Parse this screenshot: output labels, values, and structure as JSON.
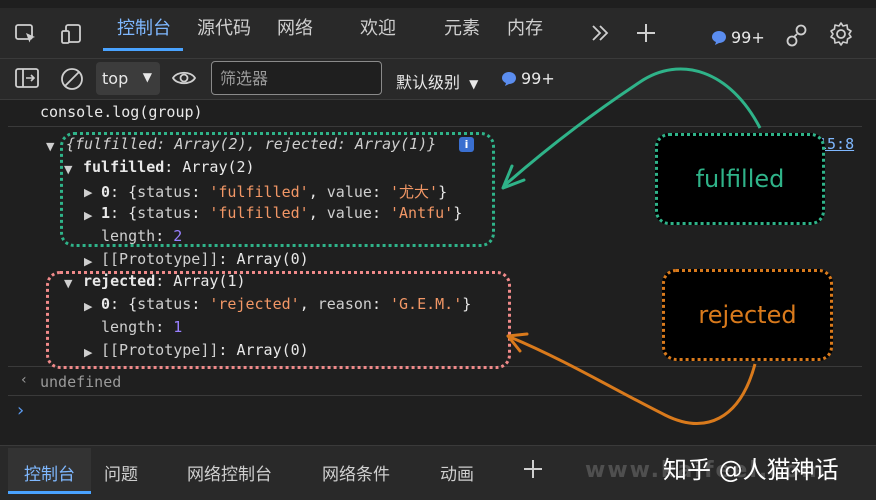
{
  "top_tabs": {
    "console": "控制台",
    "sources": "源代码",
    "network": "网络",
    "welcome": "欢迎",
    "elements": "元素",
    "memory": "内存",
    "issues_count": "99+"
  },
  "toolbar": {
    "context": "top",
    "filter_placeholder": "筛选器",
    "levels": "默认级别",
    "issues_count": "99+"
  },
  "console": {
    "command": "console.log(group)",
    "summary_open": "{",
    "summary_k1": "fulfilled",
    "summary_v1": ": Array(2), ",
    "summary_k2": "rejected",
    "summary_v2": ": Array(1)}",
    "source_link": "15:8",
    "fulfilled_key": "fulfilled",
    "fulfilled_val": ": Array(2)",
    "f0_index": "0",
    "f0_status_key": "status",
    "f0_status_val": "'fulfilled'",
    "f0_value_key": "value",
    "f0_value_val": "'尤大'",
    "f1_index": "1",
    "f1_status_key": "status",
    "f1_status_val": "'fulfilled'",
    "f1_value_key": "value",
    "f1_value_val": "'Antfu'",
    "f_length_key": "length",
    "f_length_val": "2",
    "f_proto_key": "[[Prototype]]",
    "f_proto_val": ": Array(0)",
    "rejected_key": "rejected",
    "rejected_val": ": Array(1)",
    "r0_index": "0",
    "r0_status_key": "status",
    "r0_status_val": "'rejected'",
    "r0_reason_key": "reason",
    "r0_reason_val": "'G.E.M.'",
    "r_length_key": "length",
    "r_length_val": "1",
    "r_proto_key": "[[Prototype]]",
    "r_proto_val": ": Array(0)",
    "result": "undefined"
  },
  "annotations": {
    "fulfilled_label": "fulfilled",
    "rejected_label": "rejected",
    "fulfilled_color": "#2fb389",
    "rejected_color": "#d97a1c",
    "rejected_box_color": "#f08a8a"
  },
  "drawer_tabs": {
    "console": "控制台",
    "issues": "问题",
    "network_console": "网络控制台",
    "network_conditions": "网络条件",
    "animations": "动画"
  },
  "watermark": "知乎 @人猫神话",
  "watermark_faint": "www.kaifeel.com"
}
